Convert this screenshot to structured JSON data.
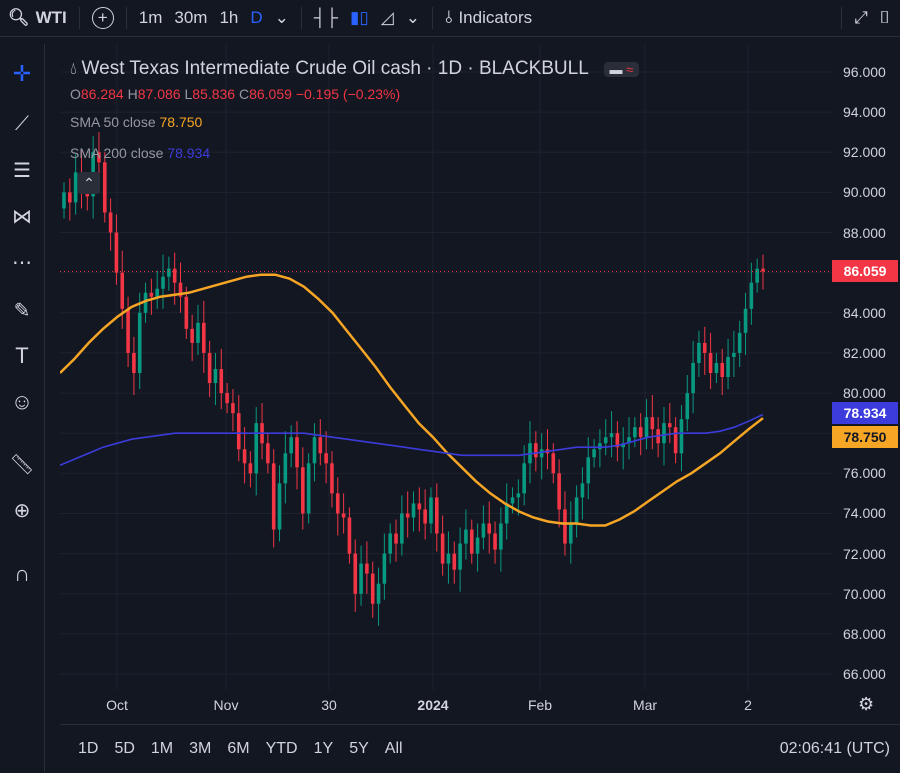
{
  "header": {
    "symbol": "WTI",
    "timeframes": [
      "1m",
      "30m",
      "1h",
      "D"
    ],
    "indicators_label": "Indicators"
  },
  "legend": {
    "title": "West Texas Intermediate Crude Oil cash · 1D · BLACKBULL",
    "ohlc": {
      "o_label": "O",
      "o": "86.284",
      "h_label": "H",
      "h": "87.086",
      "l_label": "L",
      "l": "85.836",
      "c_label": "C",
      "c": "86.059",
      "change": "−0.195 (−0.23%)"
    },
    "sma50": {
      "label": "SMA 50 close",
      "value": "78.750"
    },
    "sma200": {
      "label": "SMA 200 close",
      "value": "78.934"
    }
  },
  "colors": {
    "up": "#089981",
    "down": "#f23645",
    "sma50": "#f7a525",
    "sma200": "#3c3cdc",
    "bg": "#131722",
    "grid": "#1e222d"
  },
  "axis": {
    "price_ticks": [
      "96.000",
      "94.000",
      "92.000",
      "90.000",
      "88.000",
      "86.000",
      "84.000",
      "82.000",
      "80.000",
      "78.000",
      "76.000",
      "74.000",
      "72.000",
      "70.000",
      "68.000",
      "66.000"
    ],
    "time_ticks": [
      "Oct",
      "Nov",
      "30",
      "2024",
      "Feb",
      "Mar",
      "2"
    ]
  },
  "tags": {
    "last": "86.059",
    "sma200": "78.934",
    "sma50": "78.750"
  },
  "bottom": {
    "ranges": [
      "1D",
      "5D",
      "1M",
      "3M",
      "6M",
      "YTD",
      "1Y",
      "5Y",
      "All"
    ],
    "clock": "02:06:41 (UTC)"
  },
  "chart_data": {
    "type": "candlestick",
    "ylim": [
      65,
      97
    ],
    "series": [
      {
        "name": "SMA 50 close",
        "values": [
          81.0,
          81.7,
          82.5,
          83.2,
          83.8,
          84.3,
          84.6,
          84.8,
          84.9,
          85.0,
          85.2,
          85.4,
          85.6,
          85.8,
          85.9,
          85.9,
          85.7,
          85.3,
          84.7,
          84.0,
          83.1,
          82.2,
          81.3,
          80.3,
          79.4,
          78.5,
          77.8,
          77.0,
          76.3,
          75.6,
          75.0,
          74.5,
          74.1,
          73.8,
          73.6,
          73.5,
          73.5,
          73.4,
          73.4,
          73.7,
          74.1,
          74.6,
          75.1,
          75.6,
          76.0,
          76.5,
          77.0,
          77.6,
          78.2,
          78.75
        ]
      },
      {
        "name": "SMA 200 close",
        "values": [
          76.4,
          76.7,
          77.0,
          77.3,
          77.5,
          77.7,
          77.8,
          77.9,
          78.0,
          78.0,
          78.0,
          78.0,
          78.0,
          78.0,
          78.0,
          78.0,
          78.0,
          78.0,
          77.9,
          77.8,
          77.7,
          77.6,
          77.5,
          77.4,
          77.3,
          77.2,
          77.1,
          77.0,
          76.9,
          76.9,
          76.9,
          76.9,
          76.9,
          77.0,
          77.1,
          77.2,
          77.3,
          77.3,
          77.3,
          77.4,
          77.6,
          77.8,
          77.9,
          78.0,
          78.0,
          78.0,
          78.1,
          78.3,
          78.6,
          78.934
        ]
      }
    ]
  }
}
